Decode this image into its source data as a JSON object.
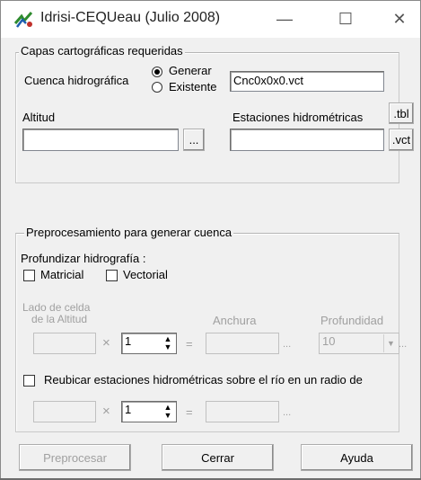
{
  "window": {
    "title": "Idrisi-CEQUeau (Julio 2008)",
    "minimize_symbol": "—",
    "maximize_symbol": "☐",
    "close_symbol": "✕"
  },
  "capas": {
    "legend": "Capas cartográficas requeridas",
    "cuenca_label": "Cuenca hidrográfica",
    "radio_generar": "Generar",
    "radio_existente": "Existente",
    "cuenca_value": "Cnc0x0x0.vct",
    "altitud_label": "Altitud",
    "altitud_value": "",
    "browse_label": "...",
    "estaciones_label": "Estaciones hidrométricas",
    "estaciones_value": "",
    "tbl_label": ".tbl",
    "vct_label": ".vct"
  },
  "preproc": {
    "legend": "Preprocesamiento para generar cuenca",
    "profundizar_label": "Profundizar hidrografía :",
    "matricial_label": "Matricial",
    "vectorial_label": "Vectorial",
    "lado_label_line1": "Lado de celda",
    "lado_label_line2": "de la Altitud",
    "anchura_label": "Anchura",
    "profundidad_label": "Profundidad",
    "row1": {
      "times": "×",
      "multiplier": "1",
      "equals": "=",
      "ellipsis1": "...",
      "profundidad_value": "10",
      "ellipsis2": "..."
    },
    "reubicar_label": "Reubicar estaciones hidrométricas sobre el río en un radio de",
    "row2": {
      "times": "×",
      "multiplier": "1",
      "equals": "=",
      "ellipsis": "..."
    }
  },
  "buttons": {
    "preprocesar": "Preprocesar",
    "cerrar": "Cerrar",
    "ayuda": "Ayuda"
  },
  "icons": {
    "app": "idrisi-app-icon",
    "spin": "up-down-arrows-icon",
    "dropdown": "chevron-down-icon"
  },
  "colors": {
    "window_bg": "#f0f0f0",
    "disabled_text": "#a0a0a0"
  }
}
